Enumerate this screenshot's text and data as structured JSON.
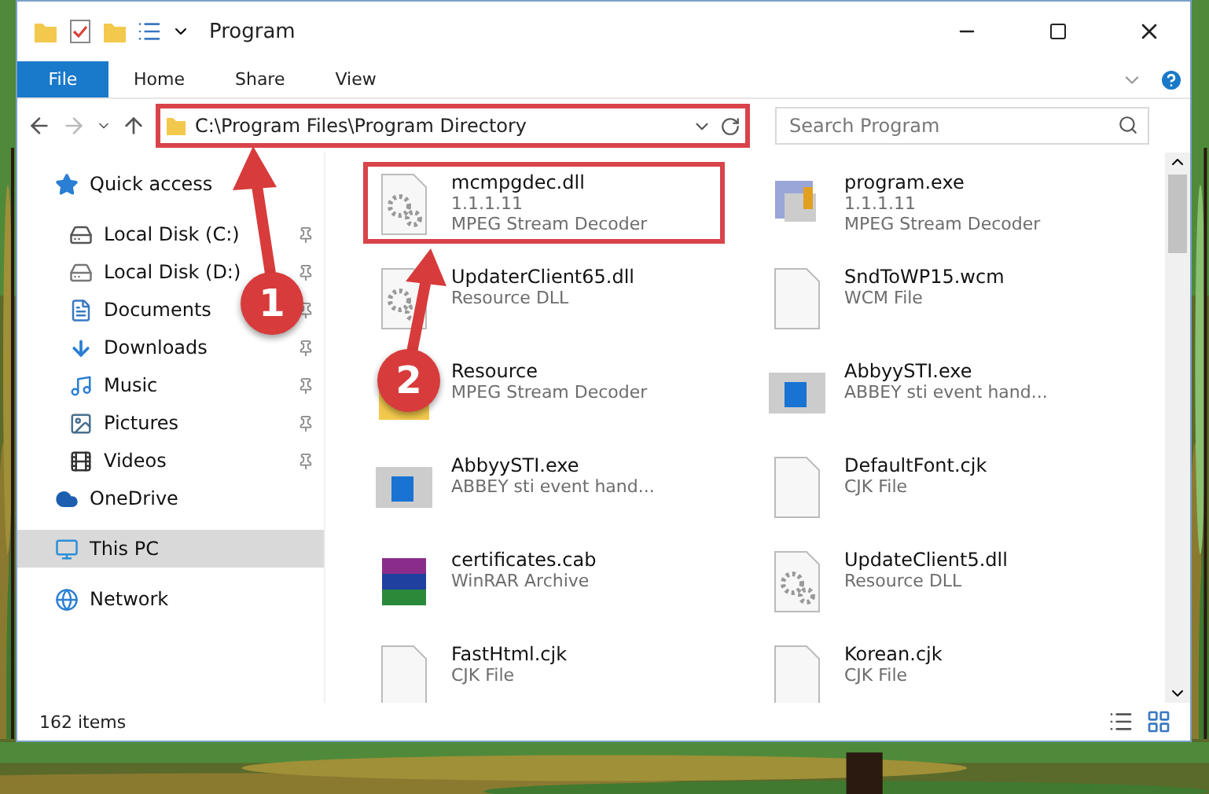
{
  "window": {
    "title": "Program"
  },
  "ribbon": {
    "tabs": [
      {
        "label": "File",
        "kind": "file"
      },
      {
        "label": "Home",
        "kind": "tab"
      },
      {
        "label": "Share",
        "kind": "tab"
      },
      {
        "label": "View",
        "kind": "tab"
      }
    ]
  },
  "address_bar": {
    "path": "C:\\Program Files\\Program Directory",
    "highlighted": true
  },
  "search": {
    "placeholder": "Search Program"
  },
  "sidebar": {
    "items": [
      {
        "label": "Quick access",
        "pinned": false,
        "selected": false,
        "children": [
          {
            "label": "Local Disk (C:)",
            "pinned": true,
            "selected": false
          },
          {
            "label": "Local Disk (D:)",
            "pinned": true,
            "selected": false
          },
          {
            "label": "Documents",
            "pinned": true,
            "selected": false
          },
          {
            "label": "Downloads",
            "pinned": true,
            "selected": false
          },
          {
            "label": "Music",
            "pinned": true,
            "selected": false
          },
          {
            "label": "Pictures",
            "pinned": true,
            "selected": false
          },
          {
            "label": "Videos",
            "pinned": true,
            "selected": false
          }
        ]
      },
      {
        "label": "OneDrive",
        "pinned": false,
        "selected": false
      },
      {
        "label": "This PC",
        "pinned": false,
        "selected": true
      },
      {
        "label": "Network",
        "pinned": false,
        "selected": false
      }
    ]
  },
  "files": [
    {
      "name": "mcmpgdec.dll",
      "lines": [
        "1.1.1.11",
        "MPEG Stream Decoder"
      ],
      "kind": "dll",
      "highlighted": true
    },
    {
      "name": "program.exe",
      "lines": [
        "1.1.1.11",
        "MPEG Stream Decoder"
      ],
      "kind": "exe",
      "highlighted": false
    },
    {
      "name": "UpdaterClient65.dll",
      "lines": [
        "Resource DLL"
      ],
      "kind": "dll",
      "highlighted": false
    },
    {
      "name": "SndToWP15.wcm",
      "lines": [
        "WCM File"
      ],
      "kind": "blank",
      "highlighted": false
    },
    {
      "name": "Resource",
      "lines": [
        "MPEG Stream Decoder"
      ],
      "kind": "folder",
      "highlighted": false
    },
    {
      "name": "AbbyySTI.exe",
      "lines": [
        "ABBEY sti event hand..."
      ],
      "kind": "window",
      "highlighted": false
    },
    {
      "name": "AbbyySTI.exe",
      "lines": [
        "ABBEY sti event hand..."
      ],
      "kind": "window",
      "highlighted": false
    },
    {
      "name": "DefaultFont.cjk",
      "lines": [
        "CJK File"
      ],
      "kind": "blank",
      "highlighted": false
    },
    {
      "name": "certificates.cab",
      "lines": [
        "WinRAR Archive"
      ],
      "kind": "archive",
      "highlighted": false
    },
    {
      "name": "UpdateClient5.dll",
      "lines": [
        "Resource DLL"
      ],
      "kind": "dll",
      "highlighted": false
    },
    {
      "name": "FastHtml.cjk",
      "lines": [
        "CJK File"
      ],
      "kind": "blank",
      "highlighted": false
    },
    {
      "name": "Korean.cjk",
      "lines": [
        "CJK File"
      ],
      "kind": "blank",
      "highlighted": false
    }
  ],
  "status_bar": {
    "count": "162 items"
  },
  "annotations": [
    {
      "label": "1"
    },
    {
      "label": "2"
    }
  ]
}
